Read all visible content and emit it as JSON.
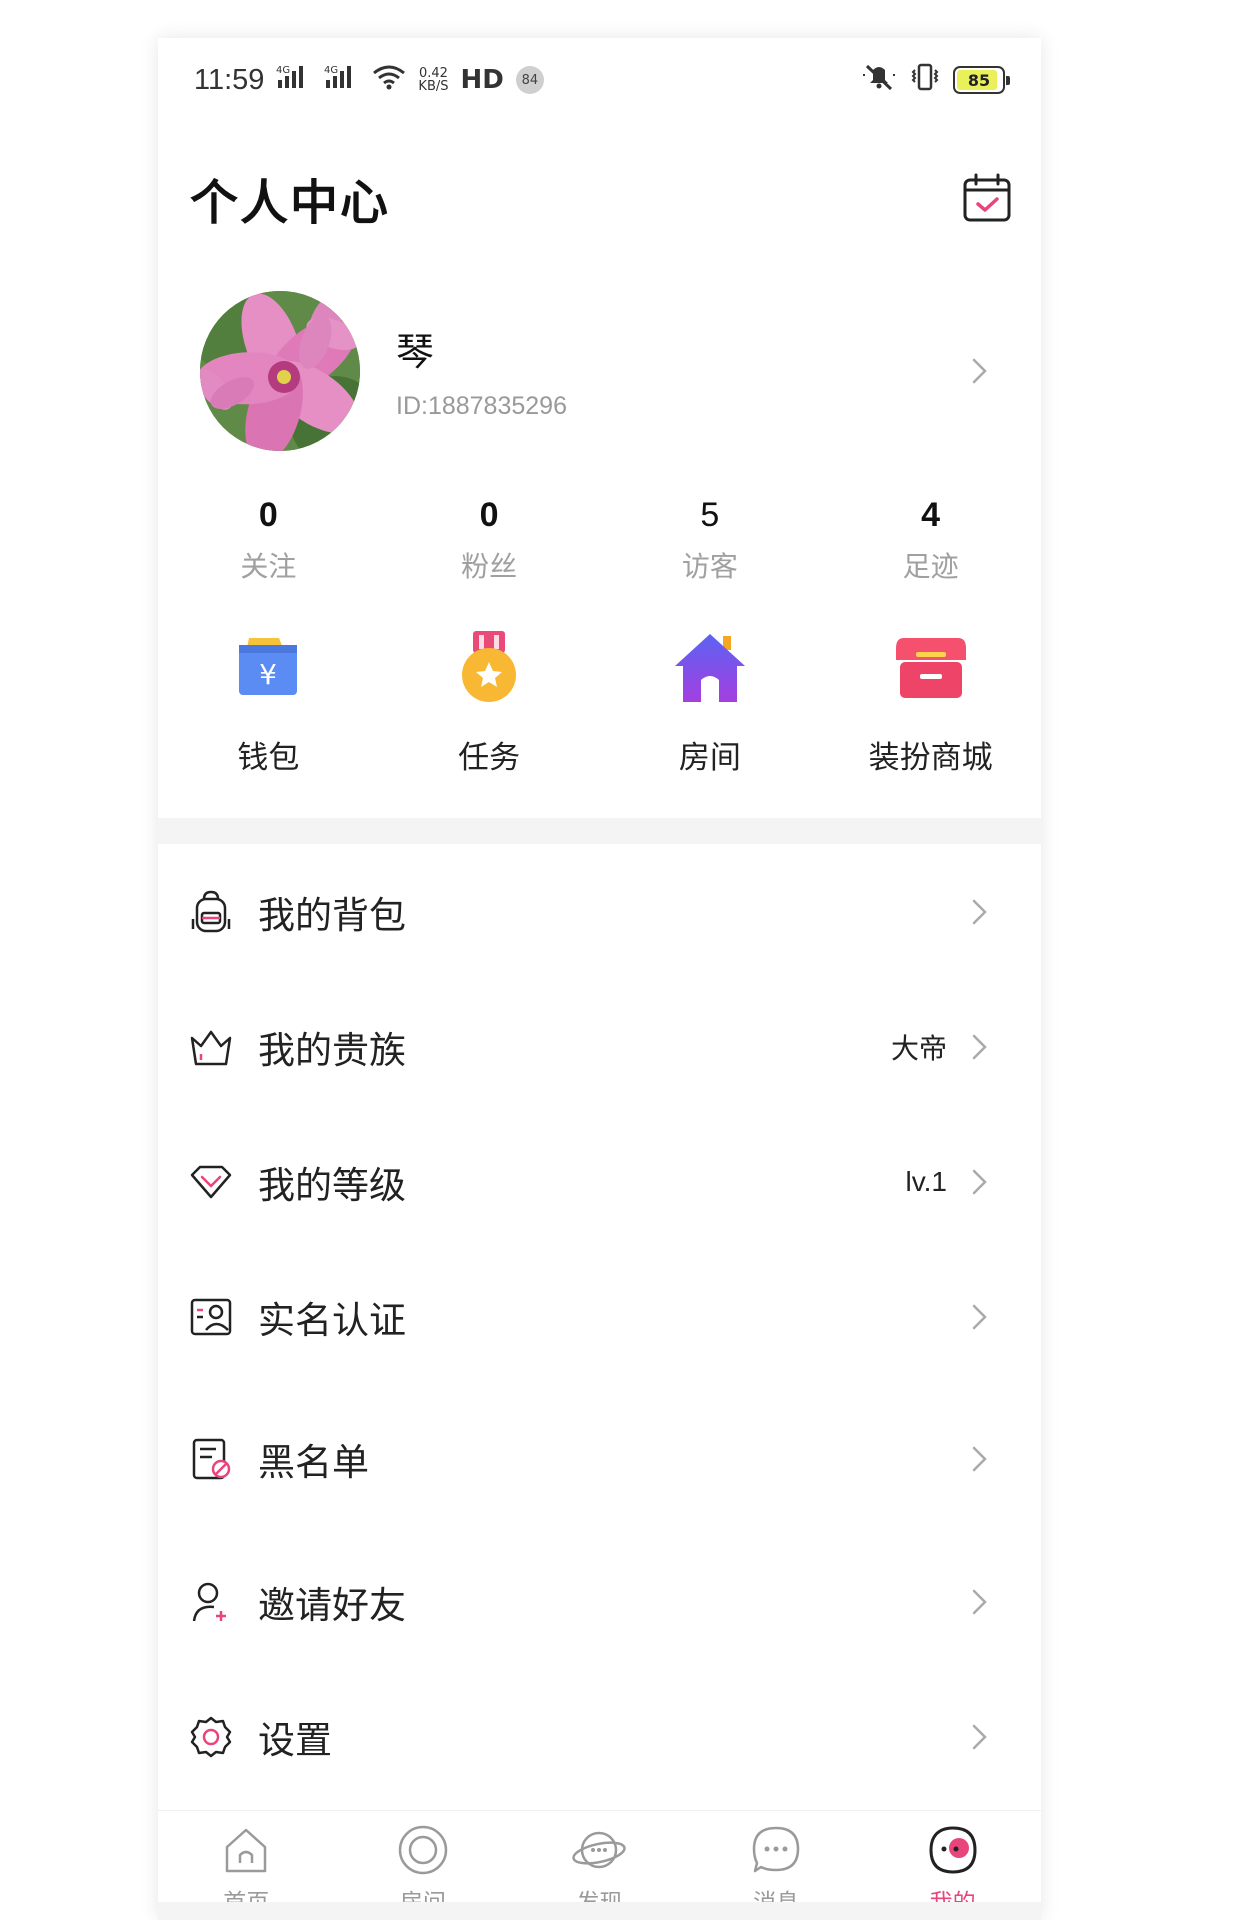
{
  "status_bar": {
    "time": "11:59",
    "signal1": "4G",
    "signal2": "4G",
    "net_speed_value": "0.42",
    "net_speed_unit": "KB/S",
    "hd_label": "HD",
    "notification_count": "84",
    "battery": "85"
  },
  "header": {
    "title": "个人中心",
    "calendar_icon": "calendar-check-icon"
  },
  "profile": {
    "nickname": "琴",
    "user_id": "ID:1887835296"
  },
  "stats": [
    {
      "value": "0",
      "label": "关注"
    },
    {
      "value": "0",
      "label": "粉丝"
    },
    {
      "value": "5",
      "label": "访客"
    },
    {
      "value": "4",
      "label": "足迹"
    }
  ],
  "shortcuts": [
    {
      "label": "钱包",
      "icon": "wallet-icon"
    },
    {
      "label": "任务",
      "icon": "task-medal-icon"
    },
    {
      "label": "房间",
      "icon": "house-icon"
    },
    {
      "label": "装扮商城",
      "icon": "store-icon"
    }
  ],
  "menu": [
    {
      "label": "我的背包",
      "value": "",
      "icon": "backpack-icon"
    },
    {
      "label": "我的贵族",
      "value": "大帝",
      "icon": "crown-icon"
    },
    {
      "label": "我的等级",
      "value": "lv.1",
      "icon": "diamond-icon"
    },
    {
      "label": "实名认证",
      "value": "",
      "icon": "id-card-icon"
    },
    {
      "label": "黑名单",
      "value": "",
      "icon": "blacklist-icon"
    },
    {
      "label": "邀请好友",
      "value": "",
      "icon": "invite-user-icon"
    },
    {
      "label": "设置",
      "value": "",
      "icon": "gear-icon"
    }
  ],
  "tabs": [
    {
      "label": "首页",
      "icon": "home-icon"
    },
    {
      "label": "房间",
      "icon": "room-ring-icon"
    },
    {
      "label": "发现",
      "icon": "planet-icon"
    },
    {
      "label": "消息",
      "icon": "chat-bubble-icon"
    },
    {
      "label": "我的",
      "icon": "profile-face-icon",
      "active": true
    }
  ],
  "colors": {
    "accent": "#e8457d",
    "text_primary": "#111111",
    "text_secondary": "#999999",
    "divider_band": "#f4f4f5"
  }
}
